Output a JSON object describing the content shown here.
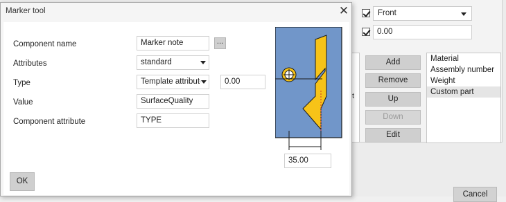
{
  "background": {
    "view_label": "Front",
    "offset_value": "0.00",
    "inner_text": "t",
    "buttons": {
      "add": "Add",
      "remove": "Remove",
      "up": "Up",
      "down": "Down",
      "edit": "Edit"
    },
    "list_items": [
      "Material",
      "Assembly number",
      "Weight",
      "Custom part"
    ],
    "selected_item": "Custom part",
    "cancel": "Cancel"
  },
  "dialog": {
    "title": "Marker tool",
    "close_glyph": "✕",
    "component_name": {
      "label": "Component name",
      "value": "Marker note",
      "browse": "..."
    },
    "attributes": {
      "label": "Attributes",
      "value": "standard"
    },
    "type": {
      "label": "Type",
      "value": "Template attribute",
      "offset": "0.00"
    },
    "value": {
      "label": "Value",
      "value": "SurfaceQuality"
    },
    "component_attribute": {
      "label": "Component attribute",
      "value": "TYPE"
    },
    "preview_dimension": "35.00",
    "ok": "OK"
  },
  "colors": {
    "preview_bg": "#7196c9",
    "marker_yellow": "#f7c318",
    "accent_red": "#d2322d"
  }
}
